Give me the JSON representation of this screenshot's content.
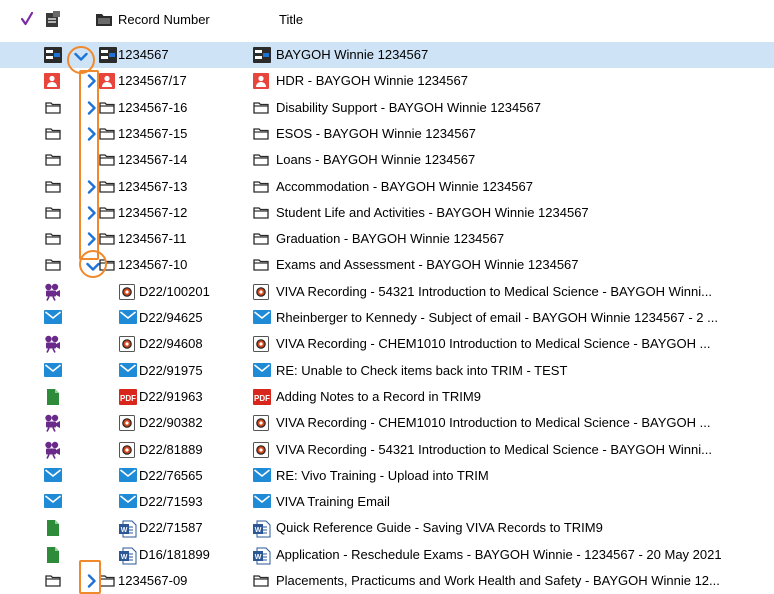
{
  "header": {
    "record_number_label": "Record Number",
    "title_label": "Title"
  },
  "colors": {
    "selection": "#cfe3f7",
    "highlight": "#f0892b",
    "chevron": "#1f73d6"
  },
  "rows": [
    {
      "rec": "1234567",
      "title": "BAYGOH Winnie 1234567",
      "icon": "container-icon",
      "expander": "expanded",
      "selected": true
    },
    {
      "rec": "1234567/17",
      "title": "HDR - BAYGOH Winnie 1234567",
      "icon": "hdr-person-icon",
      "expander": "collapsed"
    },
    {
      "rec": "1234567-16",
      "title": "Disability Support - BAYGOH Winnie 1234567",
      "icon": "folder-icon",
      "expander": "collapsed"
    },
    {
      "rec": "1234567-15",
      "title": "ESOS - BAYGOH Winnie 1234567",
      "icon": "folder-icon",
      "expander": "collapsed"
    },
    {
      "rec": "1234567-14",
      "title": "Loans - BAYGOH Winnie 1234567",
      "icon": "folder-icon",
      "expander": "none"
    },
    {
      "rec": "1234567-13",
      "title": "Accommodation - BAYGOH Winnie 1234567",
      "icon": "folder-icon",
      "expander": "collapsed"
    },
    {
      "rec": "1234567-12",
      "title": "Student Life and Activities - BAYGOH Winnie 1234567",
      "icon": "folder-icon",
      "expander": "collapsed"
    },
    {
      "rec": "1234567-11",
      "title": "Graduation - BAYGOH Winnie 1234567",
      "icon": "folder-icon",
      "expander": "collapsed"
    },
    {
      "rec": "1234567-10",
      "title": "Exams and Assessment - BAYGOH Winnie 1234567",
      "icon": "folder-icon",
      "expander": "expanded"
    },
    {
      "rec": "D22/100201",
      "title": "VIVA Recording - 54321 Introduction to Medical Science - BAYGOH Winni...",
      "icon": "media-icon",
      "status": "video-camera-icon",
      "child": true
    },
    {
      "rec": "D22/94625",
      "title": "Rheinberger to Kennedy - Subject of email - BAYGOH Winnie 1234567 - 2 ...",
      "icon": "email-icon",
      "status": "email-icon",
      "child": true
    },
    {
      "rec": "D22/94608",
      "title": "VIVA Recording - CHEM1010 Introduction to Medical Science - BAYGOH ...",
      "icon": "media-icon",
      "status": "video-camera-icon",
      "child": true
    },
    {
      "rec": "D22/91975",
      "title": "RE: Unable to Check items back into TRIM - TEST",
      "icon": "email-icon",
      "status": "email-icon",
      "child": true
    },
    {
      "rec": "D22/91963",
      "title": "Adding Notes to a Record in TRIM9",
      "icon": "pdf-icon",
      "status": "document-icon",
      "child": true
    },
    {
      "rec": "D22/90382",
      "title": "VIVA Recording - CHEM1010 Introduction to Medical Science - BAYGOH ...",
      "icon": "media-icon",
      "status": "video-camera-icon",
      "child": true
    },
    {
      "rec": "D22/81889",
      "title": "VIVA Recording - 54321 Introduction to Medical Science - BAYGOH Winni...",
      "icon": "media-icon",
      "status": "video-camera-icon",
      "child": true
    },
    {
      "rec": "D22/76565",
      "title": "RE: Vivo Training - Upload into TRIM",
      "icon": "email-icon",
      "status": "email-icon",
      "child": true
    },
    {
      "rec": "D22/71593",
      "title": "VIVA Training Email",
      "icon": "email-icon",
      "status": "email-icon",
      "child": true
    },
    {
      "rec": "D22/71587",
      "title": "Quick Reference Guide - Saving VIVA Records to TRIM9",
      "icon": "word-icon",
      "status": "document-icon",
      "child": true
    },
    {
      "rec": "D16/181899",
      "title": "Application - Reschedule Exams - BAYGOH Winnie - 1234567 - 20 May 2021",
      "icon": "word-icon",
      "status": "document-icon",
      "child": true
    },
    {
      "rec": "1234567-09",
      "title": "Placements, Practicums and Work Health and Safety - BAYGOH Winnie 12...",
      "icon": "folder-icon",
      "expander": "collapsed"
    }
  ]
}
